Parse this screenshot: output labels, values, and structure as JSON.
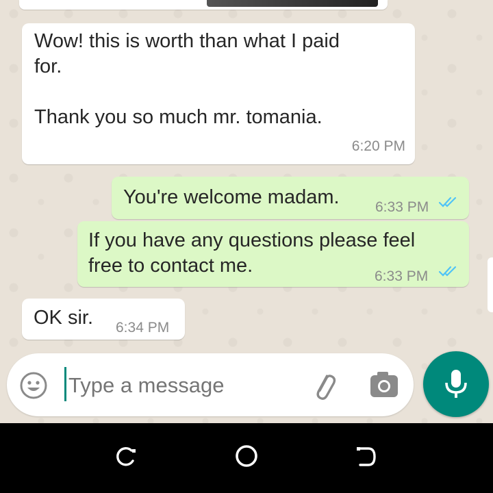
{
  "messages": [
    {
      "id": "m1",
      "direction": "incoming",
      "text": "Wow! this is worth than what I paid\nfor.\n\nThank you so much mr. tomania.",
      "time": "6:20 PM"
    },
    {
      "id": "m2",
      "direction": "outgoing",
      "text": "You're welcome madam.",
      "time": "6:33 PM",
      "status": "read"
    },
    {
      "id": "m3",
      "direction": "outgoing",
      "text": "If you have any questions please feel\nfree to contact me.",
      "time": "6:33 PM",
      "status": "read"
    },
    {
      "id": "m4",
      "direction": "incoming",
      "text": "OK sir.",
      "time": "6:34 PM"
    }
  ],
  "composer": {
    "placeholder": "Type a message",
    "emoji_icon": "emoji-icon",
    "attach_icon": "paperclip-icon",
    "camera_icon": "camera-icon",
    "mic_icon": "microphone-icon"
  },
  "navigation": {
    "recents_icon": "recents-icon",
    "home_icon": "home-icon",
    "back_icon": "back-icon"
  },
  "colors": {
    "incoming_bubble": "#ffffff",
    "outgoing_bubble": "#dcf8c6",
    "read_ticks": "#4fc3f7",
    "accent": "#00897b",
    "chat_background": "#e9e2d8"
  }
}
